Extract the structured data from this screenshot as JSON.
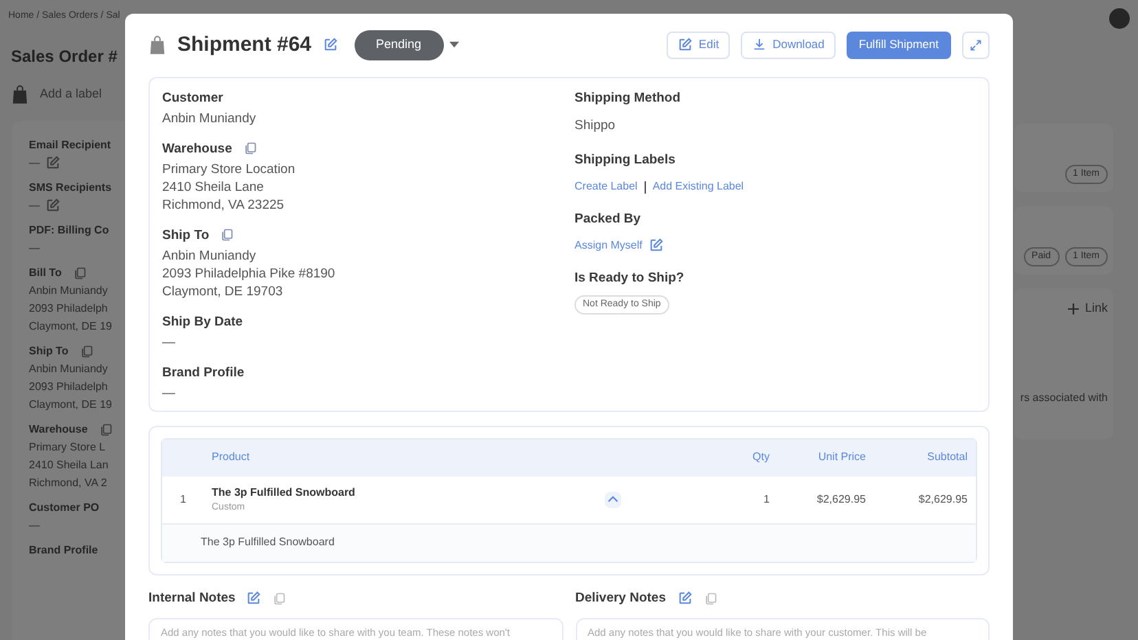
{
  "background": {
    "breadcrumb": "Home / Sales Orders / Sal",
    "title": "Sales Order #",
    "label_placeholder": "Add a label",
    "fields": [
      {
        "label": "Email Recipient",
        "lines": [
          "—"
        ],
        "kind": "recipients"
      },
      {
        "label": "SMS Recipients",
        "lines": [
          "—"
        ],
        "kind": "recipients"
      },
      {
        "label": "PDF: Billing Co",
        "lines": [
          "—"
        ],
        "kind": "plain"
      },
      {
        "label": "Bill To",
        "lines": [
          "Anbin Muniandy",
          "2093 Philadelph",
          "Claymont, DE 19"
        ],
        "kind": "address"
      },
      {
        "label": "Ship To",
        "lines": [
          "Anbin Muniandy",
          "2093 Philadelph",
          "Claymont, DE 19"
        ],
        "kind": "address"
      },
      {
        "label": "Warehouse",
        "lines": [
          "Primary Store L",
          "2410 Sheila Lan",
          "Richmond, VA 2"
        ],
        "kind": "address"
      },
      {
        "label": "Customer PO",
        "lines": [
          "—"
        ],
        "kind": "plain"
      },
      {
        "label": "Brand Profile",
        "kind": "plain"
      }
    ],
    "side_badges": [
      [
        "1 Item"
      ],
      [
        "Paid",
        "1 Item"
      ]
    ],
    "link_button": "Link",
    "side_text": "rs associated with"
  },
  "modal": {
    "title": "Shipment #64",
    "status": "Pending",
    "buttons": [
      {
        "label": "Edit",
        "kind": "edit"
      },
      {
        "label": "Download",
        "kind": "download"
      },
      {
        "label": "Fulfill Shipment",
        "kind": "primary"
      }
    ],
    "left_fields": [
      {
        "label": "Customer",
        "lines": [
          "Anbin Muniandy"
        ],
        "copy": false
      },
      {
        "label": "Warehouse",
        "lines": [
          "Primary Store Location",
          "2410 Sheila Lane",
          "Richmond, VA 23225"
        ],
        "copy": true
      },
      {
        "label": "Ship To",
        "lines": [
          "Anbin Muniandy",
          "2093 Philadelphia Pike #8190",
          "Claymont, DE 19703"
        ],
        "copy": true
      },
      {
        "label": "Ship By Date",
        "lines": [
          "—"
        ],
        "copy": false
      },
      {
        "label": "Brand Profile",
        "lines": [
          "—"
        ],
        "copy": false
      }
    ],
    "shipping_method": {
      "label": "Shipping Method",
      "value": "Shippo"
    },
    "shipping_labels": {
      "label": "Shipping Labels",
      "links": [
        "Create Label",
        "Add Existing Label"
      ]
    },
    "packed_by": {
      "label": "Packed By",
      "link": "Assign Myself"
    },
    "ready": {
      "label": "Is Ready to Ship?",
      "badge": "Not Ready to Ship"
    },
    "table": {
      "columns": [
        "Product",
        "Qty",
        "Unit Price",
        "Subtotal"
      ],
      "rows": [
        {
          "index": "1",
          "name": "The 3p Fulfilled Snowboard",
          "variant": "Custom",
          "qty": "1",
          "unit_price": "$2,629.95",
          "subtotal": "$2,629.95",
          "expanded": true,
          "detail": "The 3p Fulfilled Snowboard"
        }
      ]
    },
    "notes": [
      {
        "label": "Internal Notes",
        "placeholder": "Add any notes that you would like to share with you team. These notes won't"
      },
      {
        "label": "Delivery Notes",
        "placeholder": "Add any notes that you would like to share with your customer. This will be"
      }
    ]
  }
}
